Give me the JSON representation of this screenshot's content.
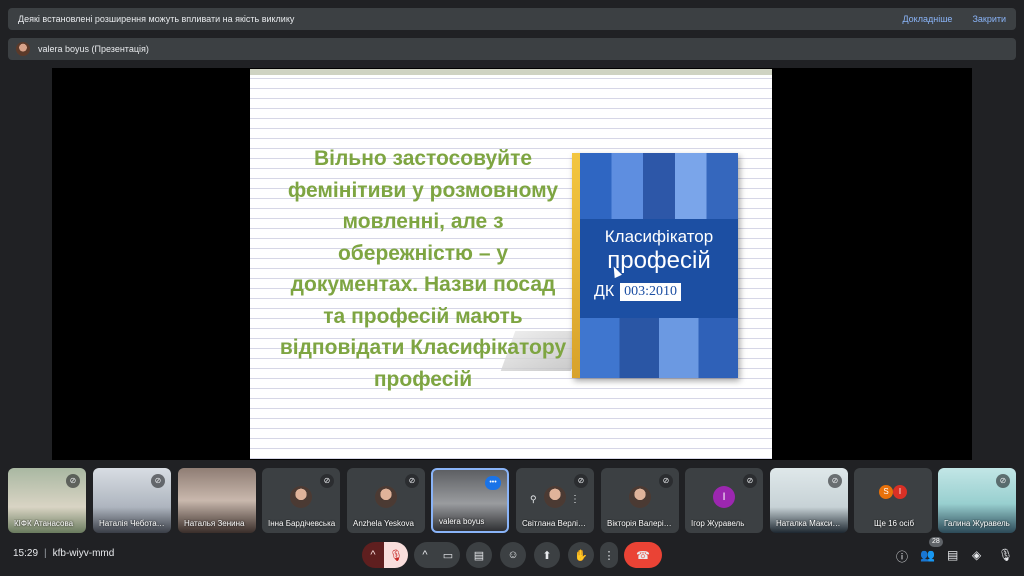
{
  "banner": {
    "message": "Деякі встановлені розширення можуть впливати на якість виклику",
    "learn_more": "Докладніше",
    "close": "Закрити"
  },
  "presenter": {
    "label": "valera boyus (Презентація)"
  },
  "slide": {
    "lines": [
      "Вільно застосовуйте",
      "фемінітиви у розмовному",
      "мовленні, але з",
      "обережністю – у",
      "документах. Назви посад",
      "та професій мають",
      "відповідати Класифікатору",
      "професій"
    ],
    "book": {
      "title_line1": "Класифікатор",
      "title_line2": "професій",
      "dk": "ДК",
      "code": "003:2010"
    },
    "colors": {
      "text": "#7ea542",
      "book": "#1c4fa3"
    }
  },
  "participants": [
    {
      "name": "КІФК Атанасова",
      "muted": true
    },
    {
      "name": "Наталія Чеботарьова",
      "muted": true
    },
    {
      "name": "Наталья Зенина",
      "muted": false
    },
    {
      "name": "Інна Бардічевська",
      "muted": true
    },
    {
      "name": "Anzhela Yeskova",
      "muted": true
    },
    {
      "name": "valera boyus",
      "speaking": true
    },
    {
      "name": "Світлана Верліцька",
      "muted": true
    },
    {
      "name": "Вікторія Валерівна",
      "muted": true
    },
    {
      "name": "Ігор Журавель",
      "muted": true,
      "initial": "І"
    },
    {
      "name": "Наталка Максименко",
      "muted": true
    },
    {
      "name": "Ще 16 осіб",
      "chips": [
        "S",
        "I"
      ]
    },
    {
      "name": "Галина Журавель",
      "muted": true
    }
  ],
  "meeting": {
    "time": "15:29",
    "separator": "|",
    "code": "kfb-wiyv-mmd",
    "people_count": "28"
  },
  "icons": {
    "chevron_up": "^",
    "mic_off": "🎙",
    "camera": "▭",
    "captions": "▤",
    "emoji": "☺",
    "present": "⬆",
    "hand": "✋",
    "more": "⋮",
    "hangup": "☎",
    "info": "ⓘ",
    "people": "👥",
    "chat": "▤",
    "activities": "◈",
    "lock": "🎙"
  }
}
